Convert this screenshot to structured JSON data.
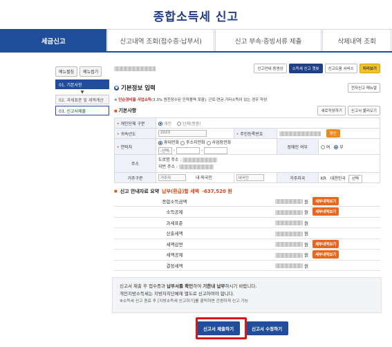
{
  "page": {
    "title": "종합소득세 신고"
  },
  "tabs": [
    {
      "label": "세금신고",
      "active": true
    },
    {
      "label": "신고내역 조회(접수증·납부서)",
      "active": false
    },
    {
      "label": "신고 부속·증빙서류 제출",
      "active": false
    },
    {
      "label": "삭제내역 조회",
      "active": false
    }
  ],
  "sidebar": {
    "expand_label": "메뉴펼침",
    "collapse_label": "메뉴접기",
    "steps": [
      {
        "label": "01. 기본사항"
      },
      {
        "label": "02. 과세표준 및 세액계산"
      },
      {
        "label": "03. 신고서제출"
      }
    ],
    "arrow": "▼"
  },
  "toolbar": {
    "guide_video": "신고안내 동영상",
    "chatbot": "소득세 신고 챗봇",
    "help_service": "신고도움 서비스",
    "preview": "미리보기",
    "manual": "전자신고 매뉴얼"
  },
  "basic_info": {
    "title": "기본정보 입력",
    "note_prefix": "※",
    "note_bold": "단순경비율 사업소득",
    "note_rest": "(3.3% 원천징수된 인적용역 포함), 근로·연금·기타소득이 있는 경우 작성",
    "subhead": "기본사항",
    "new_btn": "새로작성하기",
    "load_btn": "신고서 불러오기",
    "taxpayer_type_label": "개인단체 구분",
    "taxpayer_type_opt1": "개인",
    "taxpayer_type_opt2": "단체(종중)",
    "year_label": "귀속년도",
    "year_value": "2023",
    "rrn_label": "주민등록번호",
    "rrn_btn": "확인",
    "contact_label": "연락처",
    "contact_opt1": "휴대전화",
    "contact_opt2": "주소지전화",
    "contact_opt3": "사업장전화",
    "contact_select": "-선택-",
    "contact_dash": "-",
    "disability_label": "장애인 여부",
    "disability_yes": "여",
    "disability_no": "부",
    "address_label": "주소",
    "road_addr_label": "도로명 주소 :",
    "lot_addr_label": "지번 주소 :",
    "residence_label": "거주구분",
    "residence_value": "거주자",
    "nationality_label": "내·외국인",
    "nationality_value": "내국인",
    "country_label": "거주지국",
    "country_code": "KR",
    "country_name": "대한민국",
    "country_btn": "선택"
  },
  "summary": {
    "title": "신고 안내자료 요약",
    "tax_label": "납부(환급)할 세액",
    "tax_value": "-637,520 원",
    "currency": "원",
    "detail_btn": "세부내역보기",
    "rows": [
      {
        "label": "종합소득금액",
        "has_btn": true
      },
      {
        "label": "소득공제",
        "has_btn": true
      },
      {
        "label": "과세표준",
        "has_btn": false
      },
      {
        "label": "산출세액",
        "has_btn": false
      },
      {
        "label": "세액감면",
        "has_btn": true
      },
      {
        "label": "세액공제",
        "has_btn": true
      },
      {
        "label": "결정세액",
        "has_btn": false
      }
    ]
  },
  "notice": {
    "line1_a": "신고서 제출 후 접수증과 ",
    "line1_b": "납부서를 확인",
    "line1_c": "하여 ",
    "line1_d": "기한내 납부",
    "line1_e": "하시기 바랍니다.",
    "line2": "개인지방소득세는 지방자치단체에 별도로 신고하여야 합니다.",
    "line3": "※소득세 신고 종료 후 [지방소득세 신고하기]를 클릭하면 간편하게 신고 가능"
  },
  "actions": {
    "submit": "신고서 제출하기",
    "edit": "신고서 수정하기"
  }
}
